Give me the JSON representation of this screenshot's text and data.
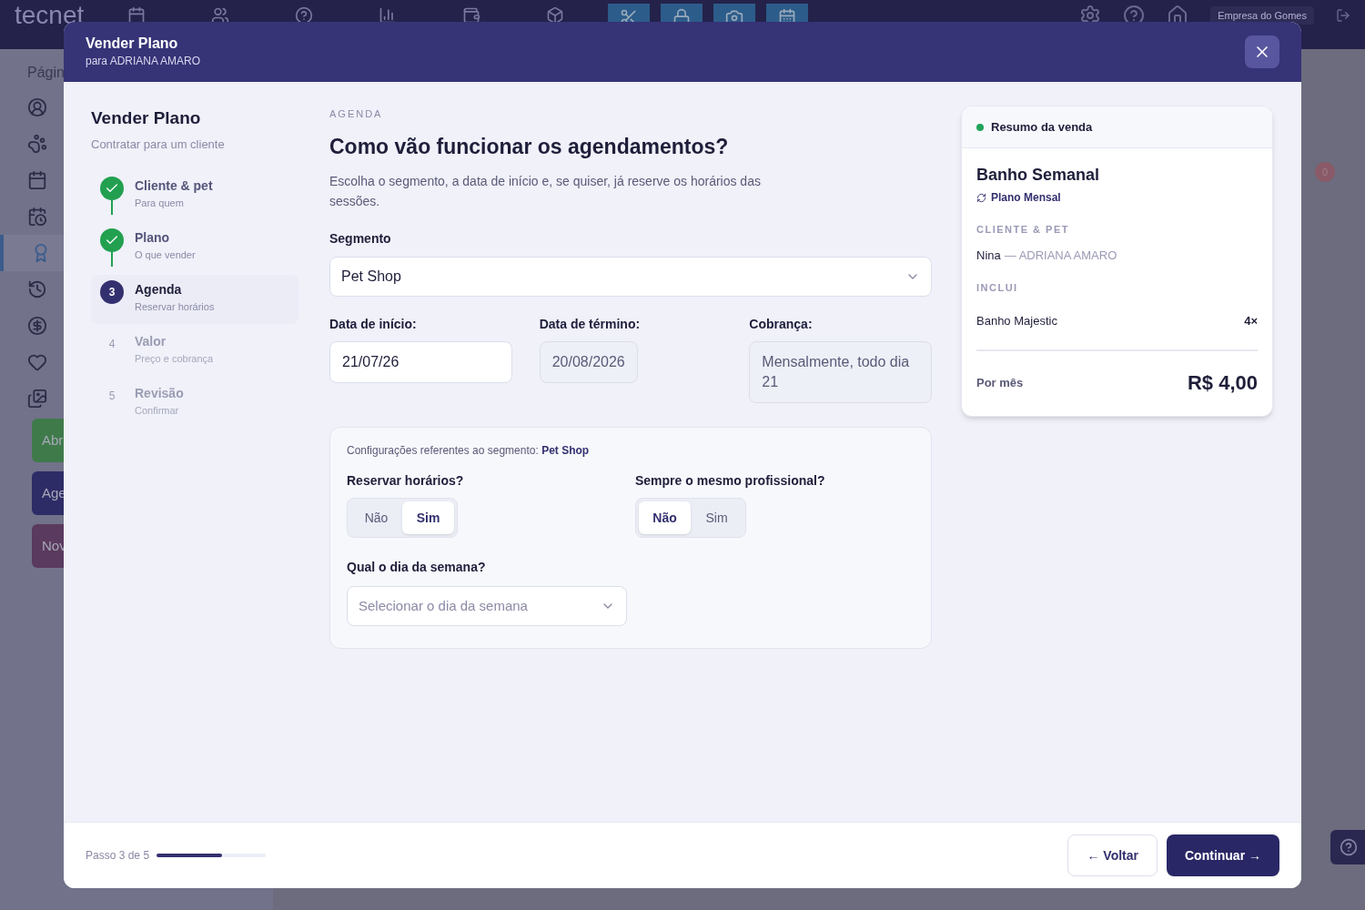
{
  "app": {
    "logo": "tecnet",
    "company": "Empresa do Gomes",
    "sidebar_heading": "Págin",
    "badge": "0",
    "sidebar_items": [
      {
        "selected": false
      },
      {
        "selected": false
      },
      {
        "selected": false
      },
      {
        "selected": false
      },
      {
        "selected": true
      },
      {
        "selected": false
      },
      {
        "selected": false
      },
      {
        "selected": false
      },
      {
        "selected": false
      }
    ],
    "sidebar_buttons": [
      {
        "label": "Abr",
        "color": "#3f7a4a"
      },
      {
        "label": "Age",
        "color": "#2e2c66"
      },
      {
        "label": "Nov",
        "color": "#5a3a5e"
      }
    ]
  },
  "modal": {
    "title": "Vender Plano",
    "subtitle": "para ADRIANA AMARO"
  },
  "wizard": {
    "title": "Vender Plano",
    "subtitle": "Contratar para um cliente",
    "steps": [
      {
        "kind": "done",
        "label": "Cliente & pet",
        "hint": "Para quem"
      },
      {
        "kind": "done",
        "label": "Plano",
        "hint": "O que vender"
      },
      {
        "kind": "current",
        "number": "3",
        "label": "Agenda",
        "hint": "Reservar horários"
      },
      {
        "kind": "pending",
        "number": "4",
        "label": "Valor",
        "hint": "Preço e cobrança"
      },
      {
        "kind": "pending",
        "number": "5",
        "label": "Revisão",
        "hint": "Confirmar"
      }
    ]
  },
  "form": {
    "eyebrow": "AGENDA",
    "title": "Como vão funcionar os agendamentos?",
    "description": "Escolha o segmento, a data de início e, se quiser, já reserve os horários das sessões.",
    "segment": {
      "label": "Segmento",
      "value": "Pet Shop"
    },
    "fields": [
      {
        "label": "Data de início:",
        "value": "21/07/26",
        "disabled": false
      },
      {
        "label": "Data de término:",
        "value": "20/08/2026",
        "disabled": true
      },
      {
        "label": "Cobrança:",
        "value": "Mensalmente, todo dia 21",
        "disabled": true
      }
    ],
    "settings": {
      "intro": "Configurações referentes ao segmento: **Pet Shop**",
      "toggles": [
        {
          "label": "Reservar horários?",
          "options": [
            {
              "label": "Não",
              "selected": false
            },
            {
              "label": "Sim",
              "selected": true
            }
          ]
        },
        {
          "label": "Sempre o mesmo profissional?",
          "options": [
            {
              "label": "Não",
              "selected": true
            },
            {
              "label": "Sim",
              "selected": false
            }
          ]
        }
      ],
      "weekday": {
        "label": "Qual o dia da semana?",
        "placeholder": "Selecionar o dia da semana"
      }
    }
  },
  "summary": {
    "heading": "Resumo da venda",
    "color": "#22a35a",
    "plan": "Banho Semanal",
    "plan_type": "Plano Mensal",
    "client_heading": "CLIENTE & PET",
    "pet": "Nina",
    "client": "— ADRIANA AMARO",
    "includes_heading": "INCLUI",
    "items": [
      {
        "name": "Banho Majestic",
        "qty": "4×"
      }
    ],
    "total_label": "Por mês",
    "total": "R$ 4,00"
  },
  "footer": {
    "step_text": "Passo 3 de 5",
    "level": 0.6,
    "back": "← Voltar",
    "next": "Continuar →"
  }
}
